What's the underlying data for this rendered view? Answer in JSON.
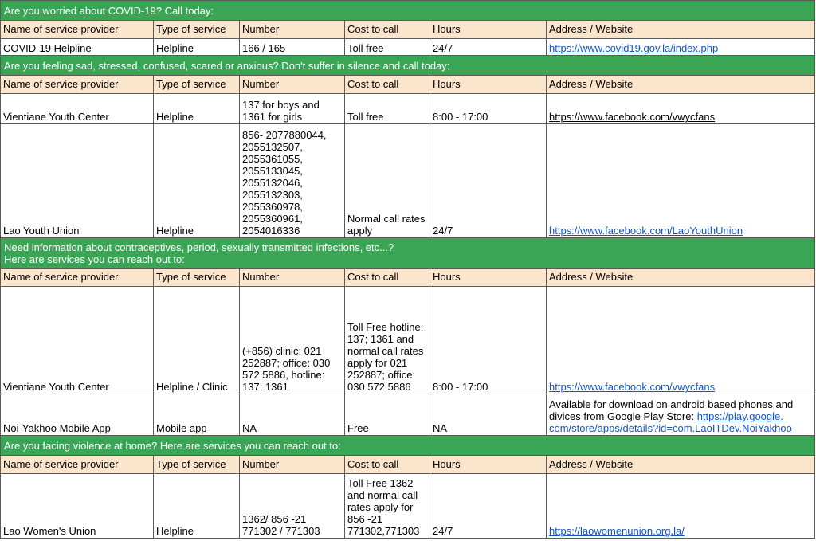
{
  "columns": [
    "Name of service provider",
    "Type of service",
    "Number",
    "Cost to call",
    "Hours",
    "Address / Website"
  ],
  "sections": [
    {
      "banner": "Are you worried about COVID-19? Call today:",
      "rows": [
        {
          "name": "COVID-19 Helpline",
          "type": "Helpline",
          "number": "166 / 165",
          "cost": "Toll free",
          "hours": "24/7",
          "website": "https://www.covid19.gov.la/index.php"
        }
      ]
    },
    {
      "banner": "Are you feeling sad, stressed, confused, scared or anxious? Don't suffer in silence and call today:",
      "rows": [
        {
          "name": "Vientiane Youth Center",
          "type": "Helpline",
          "number": "137 for boys and 1361 for girls",
          "cost": "Toll free",
          "hours": "8:00 - 17:00",
          "website": "https://www.facebook.com/vwycfans"
        },
        {
          "name": "Lao Youth Union",
          "type": "Helpline",
          "number": "856- 2077880044, 2055132507, 2055361055, 2055133045, 2055132046, 2055132303, 2055360978, 2055360961, 2054016336",
          "cost": "Normal call rates apply",
          "hours": "24/7",
          "website": "https://www.facebook.com/LaoYouthUnion"
        }
      ]
    },
    {
      "banner": "Need information about contraceptives, period, sexually transmitted infections, etc...?",
      "banner_line2": "Here are services you can reach out to:",
      "rows": [
        {
          "name": "Vientiane Youth Center",
          "type": "Helpline / Clinic",
          "number": "(+856) clinic: 021 252887; office: 030 572 5886, hotline: 137; 1361",
          "cost": "Toll Free hotline: 137; 1361 and normal call rates apply for 021 252887; office: 030 572 5886",
          "hours": "8:00 - 17:00",
          "website": "https://www.facebook.com/vwycfans"
        },
        {
          "name": "Noi-Yakhoo Mobile App",
          "type": "Mobile app",
          "number": "NA",
          "cost": "Free",
          "hours": "NA",
          "website_prefix": "Available for download on android based phones and divices from Google Play Store: ",
          "website": "https://play.google.com/store/apps/details?id=com.LaoITDev.NoiYakhoo",
          "website_display": "https://play.google. com/store/apps/details?id=com.LaoITDev.NoiYakhoo"
        }
      ]
    },
    {
      "banner": "Are you facing violence at home? Here are services you can reach out to:",
      "rows": [
        {
          "name": "Lao Women's Union",
          "type": "Helpline",
          "number": "1362/ 856 -21 771302 / 771303",
          "cost": "Toll Free 1362 and normal call rates apply for 856 -21 771302,771303",
          "hours": "24/7",
          "website": "https://laowomenunion.org.la/"
        }
      ]
    }
  ],
  "colors": {
    "banner_bg": "#3aa655",
    "header_bg": "#fce5cd",
    "link": "#1155cc",
    "border": "#5a5a5a"
  }
}
